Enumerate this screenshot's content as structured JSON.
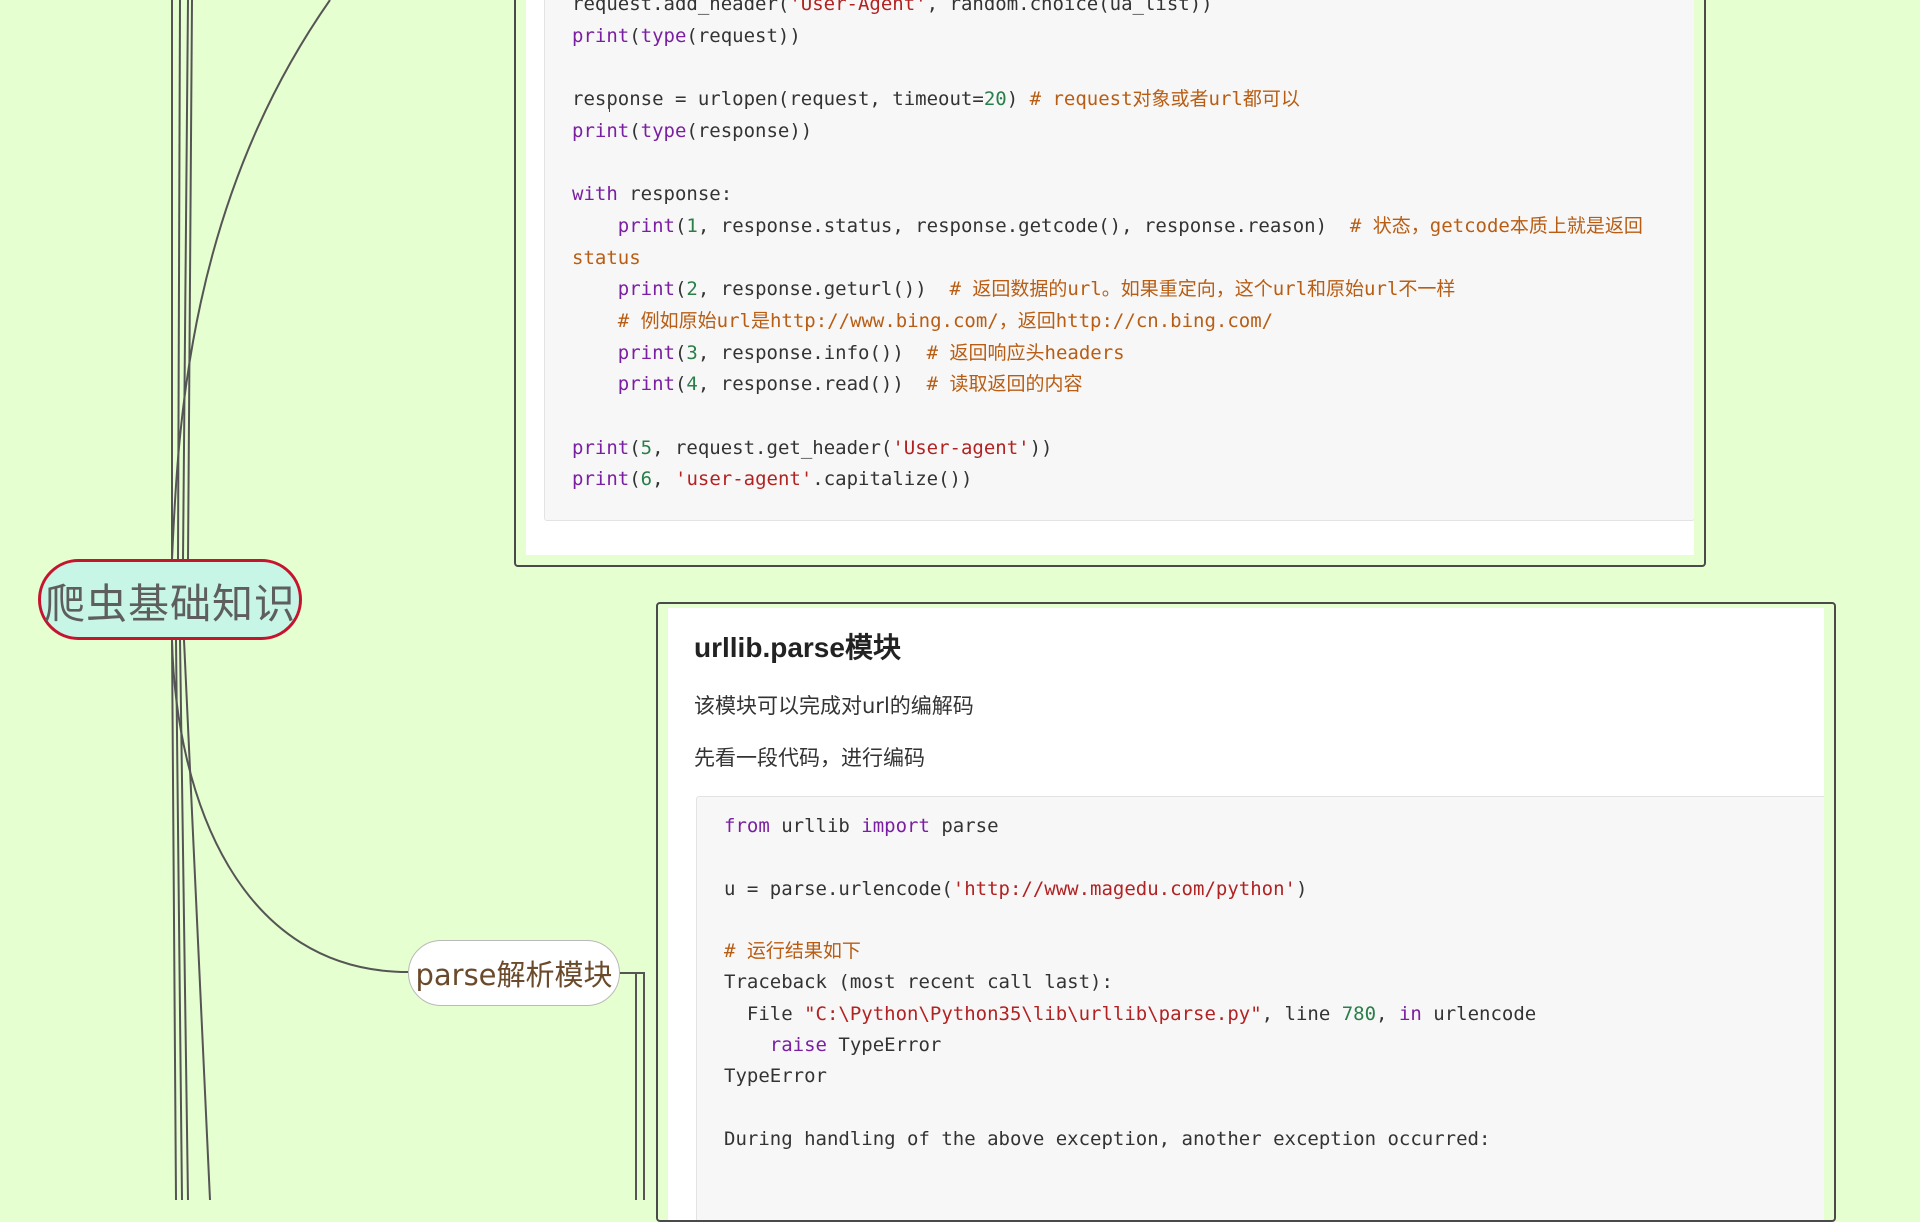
{
  "mindmap": {
    "root_label": "爬虫基础知识",
    "branch_label": "parse解析模块"
  },
  "top_card": {
    "code_lines": [
      [
        [
          "",
          "request.add_header("
        ],
        [
          "str",
          "'User-Agent'"
        ],
        [
          "",
          ", random.choice(ua_list))"
        ]
      ],
      [
        [
          "fn",
          "print"
        ],
        [
          "",
          "("
        ],
        [
          "fn",
          "type"
        ],
        [
          "",
          "(request))"
        ]
      ],
      [
        [
          "",
          ""
        ]
      ],
      [
        [
          "",
          "response = urlopen(request, timeout="
        ],
        [
          "num",
          "20"
        ],
        [
          "",
          ") "
        ],
        [
          "cm",
          "# request对象或者url都可以"
        ]
      ],
      [
        [
          "fn",
          "print"
        ],
        [
          "",
          "("
        ],
        [
          "fn",
          "type"
        ],
        [
          "",
          "(response))"
        ]
      ],
      [
        [
          "",
          ""
        ]
      ],
      [
        [
          "kw",
          "with"
        ],
        [
          "",
          " response:"
        ]
      ],
      [
        [
          "",
          "    "
        ],
        [
          "fn",
          "print"
        ],
        [
          "",
          "("
        ],
        [
          "num",
          "1"
        ],
        [
          "",
          ", response.status, response.getcode(), response.reason)  "
        ],
        [
          "cm",
          "# 状态，getcode本质上就是返回"
        ]
      ],
      [
        [
          "cm",
          "status"
        ]
      ],
      [
        [
          "",
          "    "
        ],
        [
          "fn",
          "print"
        ],
        [
          "",
          "("
        ],
        [
          "num",
          "2"
        ],
        [
          "",
          ", response.geturl())  "
        ],
        [
          "cm",
          "# 返回数据的url。如果重定向，这个url和原始url不一样"
        ]
      ],
      [
        [
          "",
          "    "
        ],
        [
          "cm",
          "# 例如原始url是http://www.bing.com/，返回http://cn.bing.com/"
        ]
      ],
      [
        [
          "",
          "    "
        ],
        [
          "fn",
          "print"
        ],
        [
          "",
          "("
        ],
        [
          "num",
          "3"
        ],
        [
          "",
          ", response.info())  "
        ],
        [
          "cm",
          "# 返回响应头headers"
        ]
      ],
      [
        [
          "",
          "    "
        ],
        [
          "fn",
          "print"
        ],
        [
          "",
          "("
        ],
        [
          "num",
          "4"
        ],
        [
          "",
          ", response.read())  "
        ],
        [
          "cm",
          "# 读取返回的内容"
        ]
      ],
      [
        [
          "",
          ""
        ]
      ],
      [
        [
          "fn",
          "print"
        ],
        [
          "",
          "("
        ],
        [
          "num",
          "5"
        ],
        [
          "",
          ", request.get_header("
        ],
        [
          "str",
          "'User-agent'"
        ],
        [
          "",
          "))"
        ]
      ],
      [
        [
          "fn",
          "print"
        ],
        [
          "",
          "("
        ],
        [
          "num",
          "6"
        ],
        [
          "",
          ", "
        ],
        [
          "str",
          "'user-agent'"
        ],
        [
          "",
          ".capitalize())"
        ]
      ]
    ]
  },
  "bottom_card": {
    "title": "urllib.parse模块",
    "paragraphs": [
      "该模块可以完成对url的编解码",
      "先看一段代码，进行编码"
    ],
    "code_lines": [
      [
        [
          "kw",
          "from"
        ],
        [
          "",
          " urllib "
        ],
        [
          "kw",
          "import"
        ],
        [
          "",
          " parse"
        ]
      ],
      [
        [
          "",
          ""
        ]
      ],
      [
        [
          "",
          "u = parse.urlencode("
        ],
        [
          "str",
          "'http://www.magedu.com/python'"
        ],
        [
          "",
          ")"
        ]
      ],
      [
        [
          "",
          ""
        ]
      ],
      [
        [
          "cm",
          "# 运行结果如下"
        ]
      ],
      [
        [
          "",
          "Traceback (most recent call last):"
        ]
      ],
      [
        [
          "",
          "  File "
        ],
        [
          "str",
          "\"C:\\Python\\Python35\\lib\\urllib\\parse.py\""
        ],
        [
          "",
          ", line "
        ],
        [
          "num",
          "780"
        ],
        [
          "",
          ", "
        ],
        [
          "kw",
          "in"
        ],
        [
          "",
          " urlencode"
        ]
      ],
      [
        [
          "",
          "    "
        ],
        [
          "kw",
          "raise"
        ],
        [
          "",
          " TypeError"
        ]
      ],
      [
        [
          "",
          "TypeError"
        ]
      ],
      [
        [
          "",
          ""
        ]
      ],
      [
        [
          "",
          "During handling of the above exception, another exception occurred:"
        ]
      ]
    ]
  },
  "colors": {
    "background": "#e6ffd0",
    "root_border": "#c4142e",
    "root_fill": "#c7f5e6",
    "connector": "#555555"
  }
}
